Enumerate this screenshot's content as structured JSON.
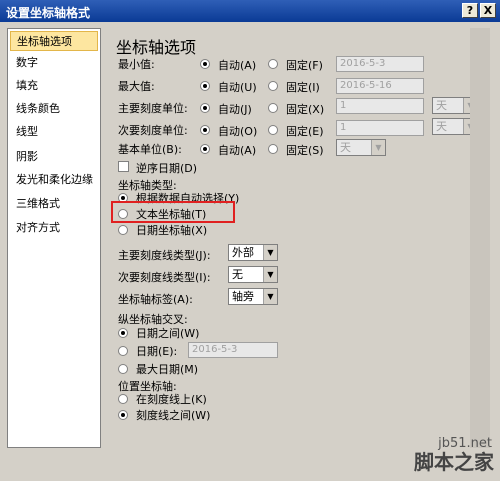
{
  "window": {
    "title": "设置坐标轴格式",
    "help_label": "?",
    "close_label": "X"
  },
  "sidebar": {
    "items": [
      {
        "label": "坐标轴选项"
      },
      {
        "label": "数字"
      },
      {
        "label": "填充"
      },
      {
        "label": "线条颜色"
      },
      {
        "label": "线型"
      },
      {
        "label": "阴影"
      },
      {
        "label": "发光和柔化边缘"
      },
      {
        "label": "三维格式"
      },
      {
        "label": "对齐方式"
      }
    ]
  },
  "panel": {
    "heading": "坐标轴选项",
    "min": {
      "label": "最小值:",
      "auto": "自动(A)",
      "fixed": "固定(F)",
      "value": "2016-5-3"
    },
    "max": {
      "label": "最大值:",
      "auto": "自动(U)",
      "fixed": "固定(I)",
      "value": "2016-5-16"
    },
    "major_unit": {
      "label": "主要刻度单位:",
      "auto": "自动(J)",
      "fixed": "固定(X)",
      "value": "1",
      "unit": "天"
    },
    "minor_unit": {
      "label": "次要刻度单位:",
      "auto": "自动(O)",
      "fixed": "固定(E)",
      "value": "1",
      "unit": "天"
    },
    "base_unit": {
      "label": "基本单位(B):",
      "auto": "自动(A)",
      "fixed": "固定(S)",
      "unit": "天"
    },
    "reverse": {
      "label": "逆序日期(D)"
    },
    "axis_type": {
      "label": "坐标轴类型:",
      "opt_auto": "根据数据自动选择(Y)",
      "opt_text": "文本坐标轴(T)",
      "opt_date": "日期坐标轴(X)"
    },
    "major_tick": {
      "label": "主要刻度线类型(J):",
      "value": "外部"
    },
    "minor_tick": {
      "label": "次要刻度线类型(I):",
      "value": "无"
    },
    "tick_label": {
      "label": "坐标轴标签(A):",
      "value": "轴旁"
    },
    "cross": {
      "label": "纵坐标轴交叉:",
      "opt_between": "日期之间(W)",
      "opt_date": "日期(E):",
      "date_value": "2016-5-3",
      "opt_max": "最大日期(M)"
    },
    "position": {
      "label": "位置坐标轴:",
      "opt_on": "在刻度线上(K)",
      "opt_between": "刻度线之间(W)"
    }
  },
  "watermark": {
    "site": "jb51.net",
    "name": "脚本之家"
  }
}
